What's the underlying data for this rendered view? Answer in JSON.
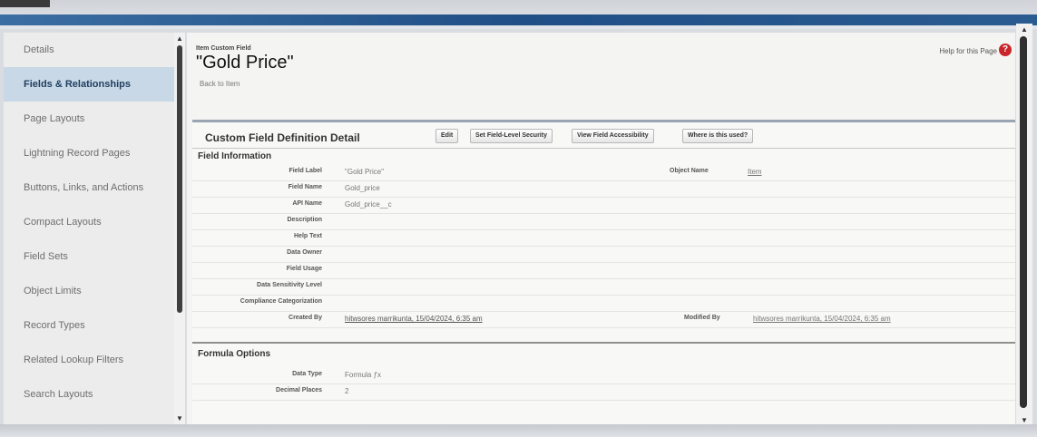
{
  "sidebar": {
    "items": [
      {
        "label": "Details",
        "active": false
      },
      {
        "label": "Fields & Relationships",
        "active": true
      },
      {
        "label": "Page Layouts",
        "active": false
      },
      {
        "label": "Lightning Record Pages",
        "active": false
      },
      {
        "label": "Buttons, Links, and Actions",
        "active": false
      },
      {
        "label": "Compact Layouts",
        "active": false
      },
      {
        "label": "Field Sets",
        "active": false
      },
      {
        "label": "Object Limits",
        "active": false
      },
      {
        "label": "Record Types",
        "active": false
      },
      {
        "label": "Related Lookup Filters",
        "active": false
      },
      {
        "label": "Search Layouts",
        "active": false
      }
    ]
  },
  "header": {
    "crumb": "Item Custom Field",
    "title": "\"Gold Price\"",
    "back_link": "Back to Item",
    "help": "Help for this Page",
    "help_icon": "?"
  },
  "detail": {
    "section_title": "Custom Field Definition Detail",
    "buttons": {
      "edit": "Edit",
      "set_fls": "Set Field-Level Security",
      "view_access": "View Field Accessibility",
      "where_used": "Where is this used?"
    },
    "field_information": "Field Information",
    "rows": [
      {
        "label": "Field Label",
        "value": "\"Gold Price\""
      },
      {
        "label": "Field Name",
        "value": "Gold_price"
      },
      {
        "label": "API Name",
        "value": "Gold_price__c"
      },
      {
        "label": "Description",
        "value": ""
      },
      {
        "label": "Help Text",
        "value": ""
      },
      {
        "label": "Data Owner",
        "value": ""
      },
      {
        "label": "Field Usage",
        "value": ""
      },
      {
        "label": "Data Sensitivity Level",
        "value": ""
      },
      {
        "label": "Compliance Categorization",
        "value": ""
      },
      {
        "label": "Created By",
        "value": "hitwsores marrikunta, 15/04/2024, 6:35 am"
      }
    ],
    "object_name_label": "Object Name",
    "object_name_value": "Item",
    "modified_by_label": "Modified By",
    "modified_by_value": "hitwsores marrikunta, 15/04/2024, 6:35 am",
    "formula_options": "Formula Options",
    "formula_rows": [
      {
        "label": "Data Type",
        "value": "Formula ƒx"
      },
      {
        "label": "Decimal Places",
        "value": "2"
      }
    ]
  },
  "colors": {
    "topbar_blue": "#1f4f86",
    "active_item": "#c8d8e6",
    "help_red": "#c9262c"
  }
}
